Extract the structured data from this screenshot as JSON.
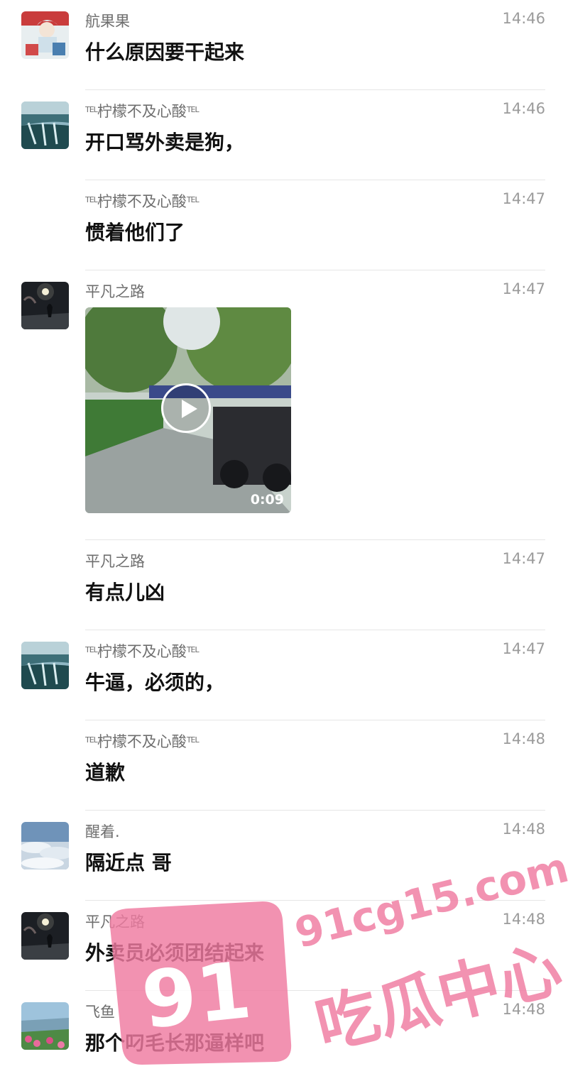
{
  "messages": [
    {
      "sender": "航果果",
      "tag_pre": "",
      "tag_post": "",
      "time": "14:46",
      "text": "什么原因要干起来",
      "avatar": "anime-figure"
    },
    {
      "sender": "柠檬不及心酸",
      "tag_pre": "TEL",
      "tag_post": "TEL",
      "time": "14:46",
      "text": "开口骂外卖是狗，",
      "avatar": "waterfall"
    },
    {
      "sender": "柠檬不及心酸",
      "tag_pre": "TEL",
      "tag_post": "TEL",
      "time": "14:47",
      "text": "惯着他们了",
      "avatar": ""
    },
    {
      "sender": "平凡之路",
      "tag_pre": "",
      "tag_post": "",
      "time": "14:47",
      "text": "",
      "avatar": "night-moon",
      "video": {
        "duration": "0:09"
      }
    },
    {
      "sender": "平凡之路",
      "tag_pre": "",
      "tag_post": "",
      "time": "14:47",
      "text": "有点儿凶",
      "avatar": ""
    },
    {
      "sender": "柠檬不及心酸",
      "tag_pre": "TEL",
      "tag_post": "TEL",
      "time": "14:47",
      "text": "牛逼，必须的，",
      "avatar": "waterfall"
    },
    {
      "sender": "柠檬不及心酸",
      "tag_pre": "TEL",
      "tag_post": "TEL",
      "time": "14:48",
      "text": "道歉",
      "avatar": ""
    },
    {
      "sender": "醒着.",
      "tag_pre": "",
      "tag_post": "",
      "time": "14:48",
      "text": "隔近点 哥",
      "avatar": "sky-clouds"
    },
    {
      "sender": "平凡之路",
      "tag_pre": "",
      "tag_post": "",
      "time": "14:48",
      "text": "外卖员必须团结起来",
      "avatar": "night-moon"
    },
    {
      "sender": "飞鱼",
      "tag_pre": "",
      "tag_post": "",
      "time": "14:48",
      "text": "那个叼毛长那逼样吧",
      "avatar": "coast-flowers"
    }
  ],
  "watermark": {
    "url": "91cg15.com",
    "number": "91",
    "name": "吃瓜中心",
    "color": "#f07aa0"
  }
}
